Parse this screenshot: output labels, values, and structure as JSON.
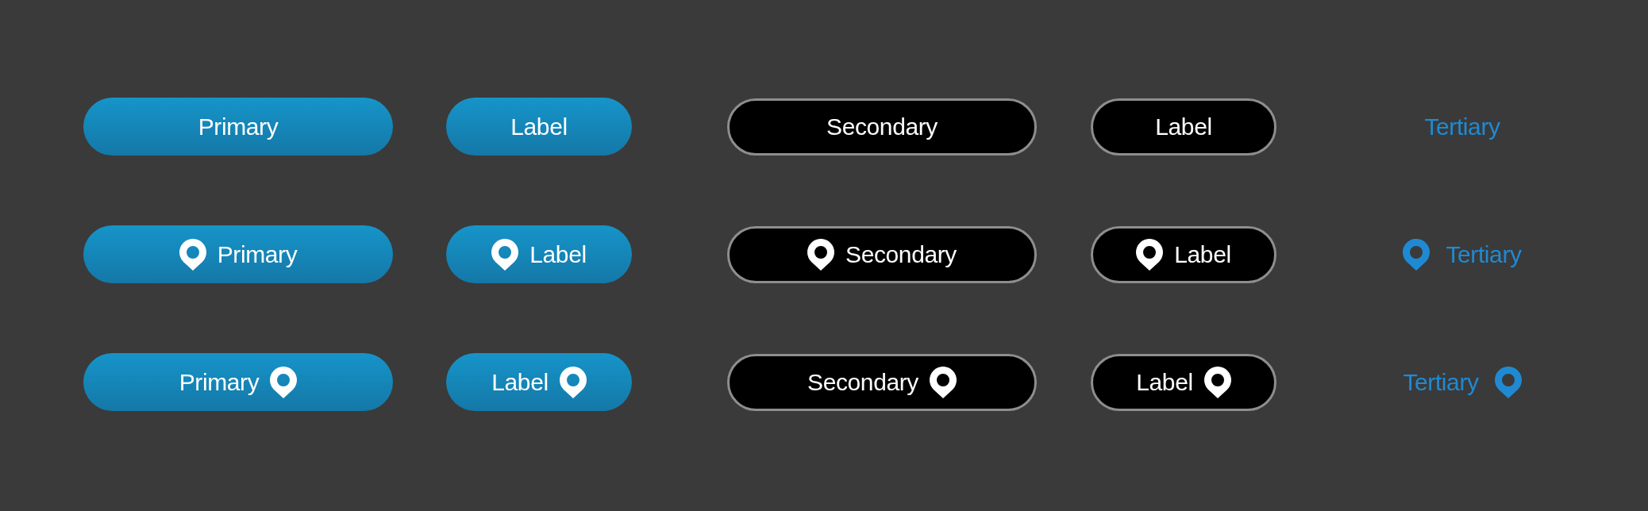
{
  "rows": [
    {
      "kind": "plain",
      "buttons": [
        {
          "kind": "primary",
          "label": "Primary"
        },
        {
          "kind": "primary",
          "label": "Label"
        },
        {
          "kind": "secondary",
          "label": "Secondary"
        },
        {
          "kind": "secondary",
          "label": "Label"
        },
        {
          "kind": "tertiary",
          "label": "Tertiary"
        }
      ]
    },
    {
      "kind": "leading",
      "buttons": [
        {
          "kind": "primary",
          "label": "Primary"
        },
        {
          "kind": "primary",
          "label": "Label"
        },
        {
          "kind": "secondary",
          "label": "Secondary"
        },
        {
          "kind": "secondary",
          "label": "Label"
        },
        {
          "kind": "tertiary",
          "label": "Tertiary"
        }
      ]
    },
    {
      "kind": "trailing",
      "buttons": [
        {
          "kind": "primary",
          "label": "Primary"
        },
        {
          "kind": "primary",
          "label": "Label"
        },
        {
          "kind": "secondary",
          "label": "Secondary"
        },
        {
          "kind": "secondary",
          "label": "Label"
        },
        {
          "kind": "tertiary",
          "label": "Tertiary"
        }
      ]
    }
  ]
}
